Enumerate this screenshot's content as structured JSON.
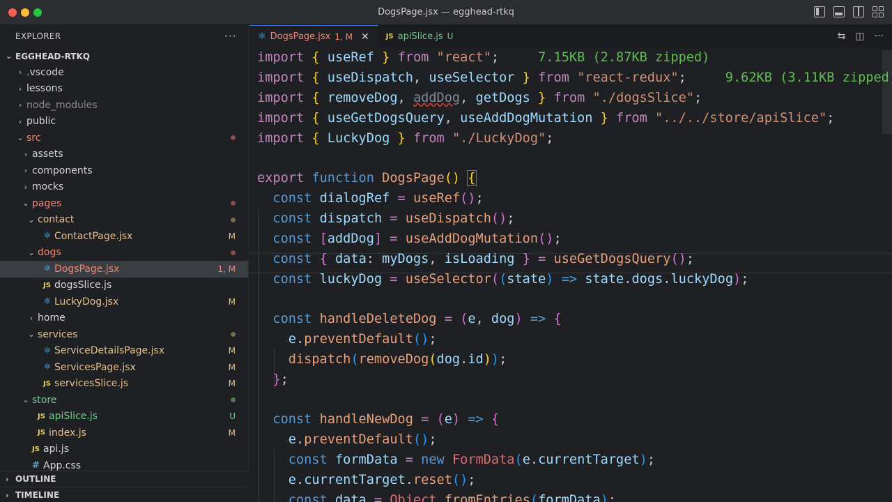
{
  "window": {
    "title": "DogsPage.jsx — egghead-rtkq"
  },
  "sidebar": {
    "header": "EXPLORER",
    "more": "···",
    "project": "EGGHEAD-RTKQ",
    "items": [
      {
        "label": ".vscode",
        "indent": 0,
        "kind": "folder",
        "open": false,
        "status": ""
      },
      {
        "label": "lessons",
        "indent": 0,
        "kind": "folder",
        "open": false,
        "status": ""
      },
      {
        "label": "node_modules",
        "indent": 0,
        "kind": "folder",
        "open": false,
        "status": "dim"
      },
      {
        "label": "public",
        "indent": 0,
        "kind": "folder",
        "open": false,
        "status": ""
      },
      {
        "label": "src",
        "indent": 0,
        "kind": "folder",
        "open": true,
        "status": "err-dot"
      },
      {
        "label": "assets",
        "indent": 1,
        "kind": "folder",
        "open": false,
        "status": ""
      },
      {
        "label": "components",
        "indent": 1,
        "kind": "folder",
        "open": false,
        "status": ""
      },
      {
        "label": "mocks",
        "indent": 1,
        "kind": "folder",
        "open": false,
        "status": ""
      },
      {
        "label": "pages",
        "indent": 1,
        "kind": "folder",
        "open": true,
        "status": "err-dot"
      },
      {
        "label": "contact",
        "indent": 2,
        "kind": "folder",
        "open": true,
        "status": "mod-dot"
      },
      {
        "label": "ContactPage.jsx",
        "indent": 3,
        "kind": "react",
        "status": "M"
      },
      {
        "label": "dogs",
        "indent": 2,
        "kind": "folder",
        "open": true,
        "status": "err-dot"
      },
      {
        "label": "DogsPage.jsx",
        "indent": 3,
        "kind": "react",
        "status": "1, M",
        "selected": true
      },
      {
        "label": "dogsSlice.js",
        "indent": 3,
        "kind": "js",
        "status": ""
      },
      {
        "label": "LuckyDog.jsx",
        "indent": 3,
        "kind": "react",
        "status": "M"
      },
      {
        "label": "home",
        "indent": 2,
        "kind": "folder",
        "open": false,
        "status": ""
      },
      {
        "label": "services",
        "indent": 2,
        "kind": "folder",
        "open": true,
        "status": "mod-dot"
      },
      {
        "label": "ServiceDetailsPage.jsx",
        "indent": 3,
        "kind": "react",
        "status": "M"
      },
      {
        "label": "ServicesPage.jsx",
        "indent": 3,
        "kind": "react",
        "status": "M"
      },
      {
        "label": "servicesSlice.js",
        "indent": 3,
        "kind": "js",
        "status": "M"
      },
      {
        "label": "store",
        "indent": 1,
        "kind": "folder",
        "open": true,
        "status": "untr-dot"
      },
      {
        "label": "apiSlice.js",
        "indent": 2,
        "kind": "js",
        "status": "U"
      },
      {
        "label": "index.js",
        "indent": 2,
        "kind": "js",
        "status": "M"
      },
      {
        "label": "api.js",
        "indent": 1,
        "kind": "js",
        "status": ""
      },
      {
        "label": "App.css",
        "indent": 1,
        "kind": "css",
        "status": ""
      }
    ],
    "outline": "OUTLINE",
    "timeline": "TIMELINE"
  },
  "tabs": [
    {
      "label": "DogsPage.jsx",
      "status": "1, M",
      "icon": "react",
      "active": true
    },
    {
      "label": "apiSlice.js",
      "status": "U",
      "icon": "js",
      "active": false
    }
  ],
  "code": {
    "import_size_1": "7.15KB (2.87KB zipped)",
    "import_size_2": "9.62KB (3.11KB zipped)"
  },
  "colors": {
    "accent": "#3a7bd5",
    "modified": "#e2c08d",
    "untracked": "#73c991",
    "error": "#f48771"
  }
}
